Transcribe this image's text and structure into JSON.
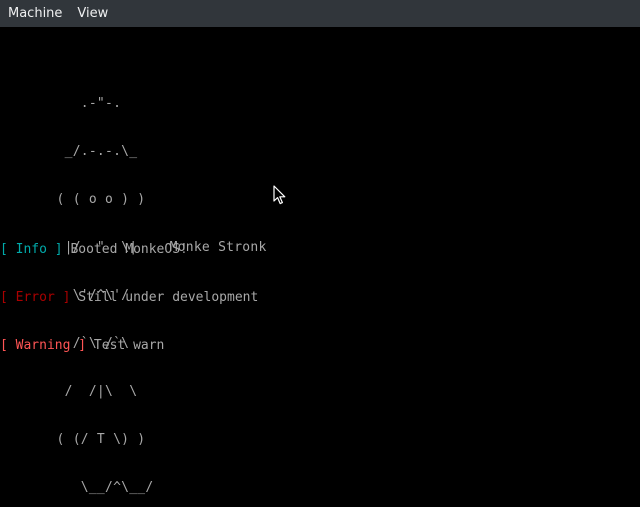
{
  "menubar": {
    "items": [
      {
        "label": "Machine"
      },
      {
        "label": "View"
      }
    ]
  },
  "terminal": {
    "ascii_art": [
      "          .-\"-.",
      "        _/.-.-.\\_",
      "       ( ( o o ) )",
      "        |/  \"  \\|    Monke Stronk",
      "         \\'/^\\'/",
      "         /`\\ /`\\",
      "        /  /|\\  \\",
      "       ( (/ T \\) )",
      "          \\__/^\\__/"
    ],
    "logs": [
      {
        "open": "[ ",
        "tag": "Info",
        "close": " ]",
        "message": " Booted MonkeOS!",
        "level": "info"
      },
      {
        "open": "[ ",
        "tag": "Error",
        "close": " ]",
        "message": " Still under development",
        "level": "error"
      },
      {
        "open": "[ ",
        "tag": "Warning",
        "close": " ]",
        "message": " Test warn",
        "level": "warn"
      }
    ]
  },
  "colors": {
    "menubar_bg": "#31363b",
    "menubar_text": "#eff0f1",
    "screen_bg": "#000000",
    "text_default": "#a8a8a8",
    "info": "#00aaaa",
    "error": "#aa0000",
    "warning": "#ff5555"
  },
  "icons": {
    "pointer": "mouse-pointer-icon"
  }
}
